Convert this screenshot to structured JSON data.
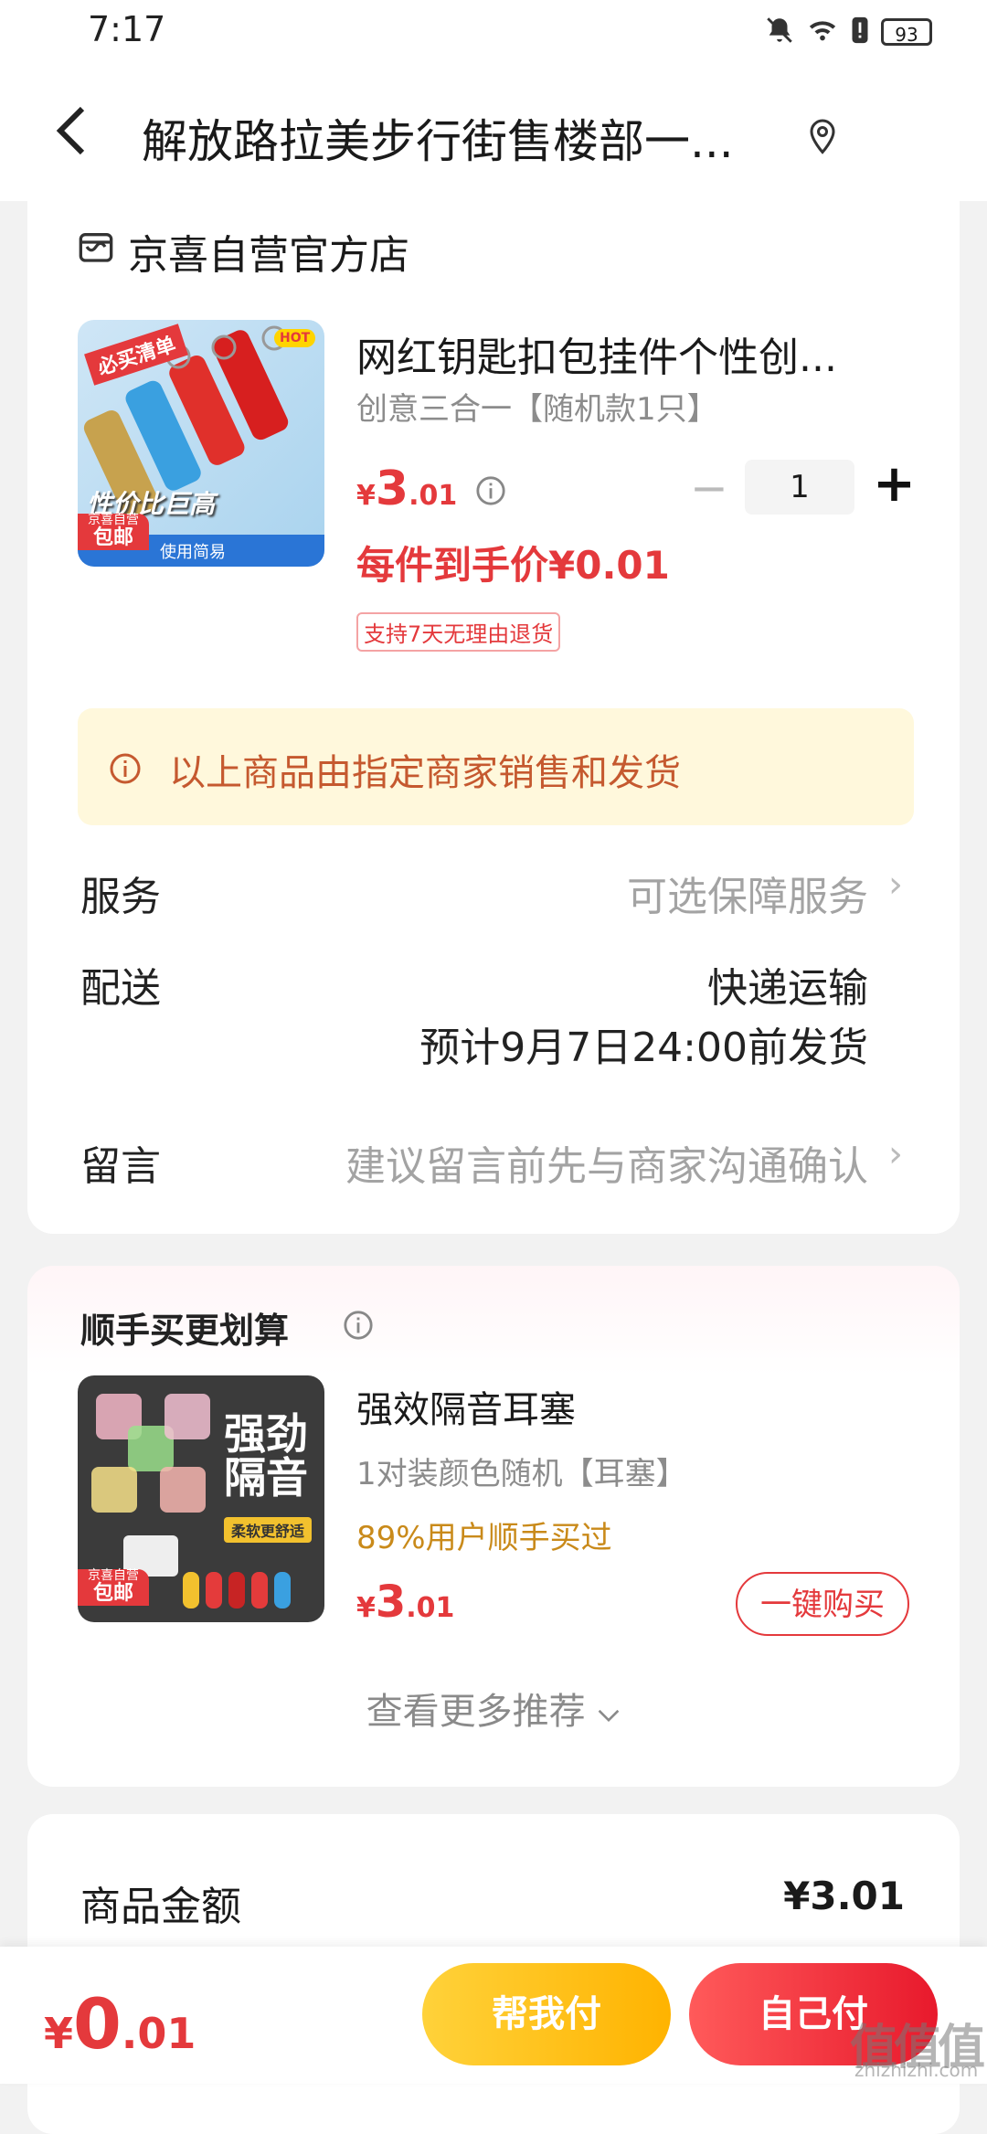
{
  "status_bar": {
    "time": "7:17",
    "battery": "93"
  },
  "header": {
    "title": "解放路拉美步行街售楼部一..."
  },
  "store": {
    "name": "京喜自营官方店"
  },
  "product": {
    "image_text": {
      "tag": "必买清单",
      "hot": "HOT",
      "slogan": "性价比巨高",
      "badge_top": "京喜自营",
      "badge_bottom": "包邮",
      "strip": "使用简易"
    },
    "name": "网红钥匙扣包挂件个性创...",
    "spec": "创意三合一【随机款1只】",
    "price_symbol": "¥",
    "price_int": "3",
    "price_dec": ".01",
    "quantity": "1",
    "per_price": "每件到手价¥0.01",
    "return_tag": "支持7天无理由退货"
  },
  "notice": "以上商品由指定商家销售和发货",
  "rows": {
    "service_label": "服务",
    "service_value": "可选保障服务",
    "delivery_label": "配送",
    "delivery_value": "快递运输",
    "delivery_eta": "预计9月7日24:00前发货",
    "message_label": "留言",
    "message_placeholder": "建议留言前先与商家沟通确认"
  },
  "addon": {
    "title": "顺手买更划算",
    "image_text": {
      "line1": "强劲",
      "line2": "隔音",
      "sub": "柔软更舒适",
      "badge_top": "京喜自营",
      "badge_bottom": "包邮"
    },
    "name": "强效隔音耳塞",
    "spec": "1对装颜色随机【耳塞】",
    "bought": "89%用户顺手买过",
    "price_symbol": "¥",
    "price_int": "3",
    "price_dec": ".01",
    "buy_label": "一键购买",
    "more_label": "查看更多推荐"
  },
  "summary": {
    "goods_label": "商品金额",
    "goods_value": "¥3.01"
  },
  "bottom_bar": {
    "total_symbol": "¥",
    "total_int": "0",
    "total_dec": ".01",
    "help_pay_label": "帮我付",
    "self_pay_label": "自己付"
  },
  "watermark": {
    "logo": "值值值",
    "site": "zhizhizhi.com"
  },
  "colors": {
    "accent": "#e4393c",
    "notice_bg": "#fff8dc",
    "help_btn": "#ffc21a",
    "self_btn": "#f0303a"
  }
}
